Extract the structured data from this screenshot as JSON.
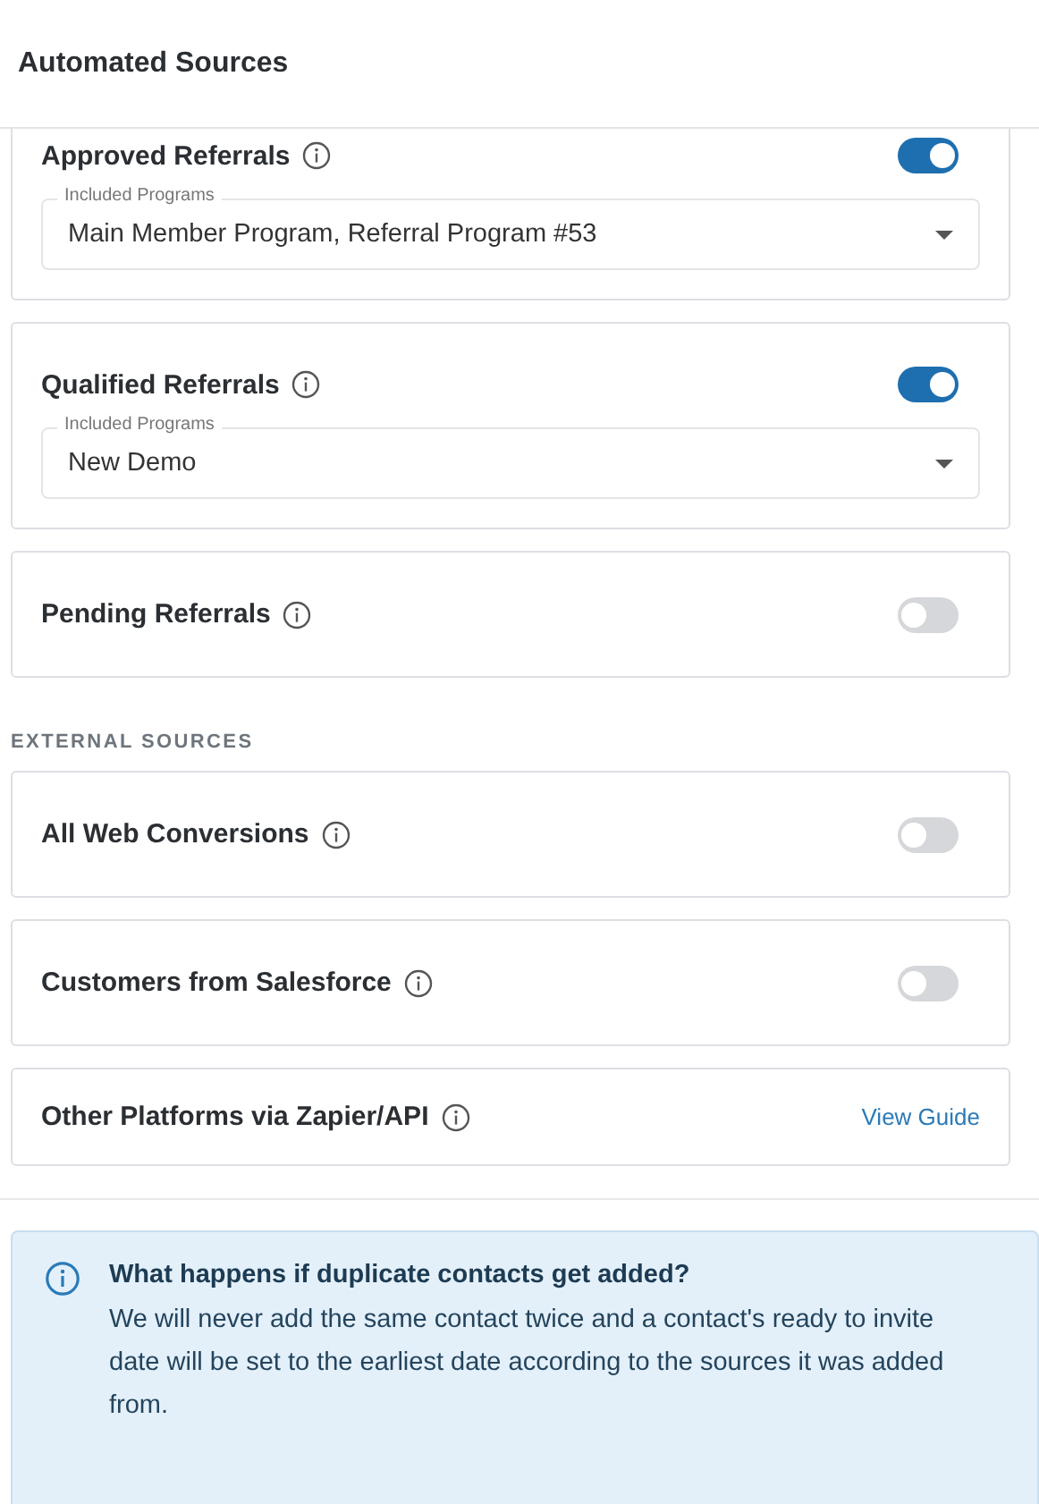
{
  "header": {
    "title": "Automated Sources"
  },
  "referral_sources": [
    {
      "kind": "toggle",
      "label": "Approved Referrals",
      "on": true,
      "field": {
        "label": "Included Programs",
        "value": "Main Member Program, Referral Program #53"
      }
    },
    {
      "kind": "toggle",
      "label": "Qualified Referrals",
      "on": true,
      "field": {
        "label": "Included Programs",
        "value": "New Demo"
      }
    },
    {
      "kind": "toggle",
      "label": "Pending Referrals",
      "on": false
    }
  ],
  "external_section": {
    "heading": "EXTERNAL SOURCES",
    "items": [
      {
        "kind": "toggle",
        "label": "All Web Conversions",
        "on": false
      },
      {
        "kind": "toggle",
        "label": "Customers from Salesforce",
        "on": false
      },
      {
        "kind": "link",
        "label": "Other Platforms via Zapier/API",
        "link": "View Guide"
      }
    ]
  },
  "info_box": {
    "title": "What happens if duplicate contacts get added?",
    "text": "We will never add the same contact twice and a contact's ready to invite date will be set to the earliest date according to the sources it was added from."
  }
}
